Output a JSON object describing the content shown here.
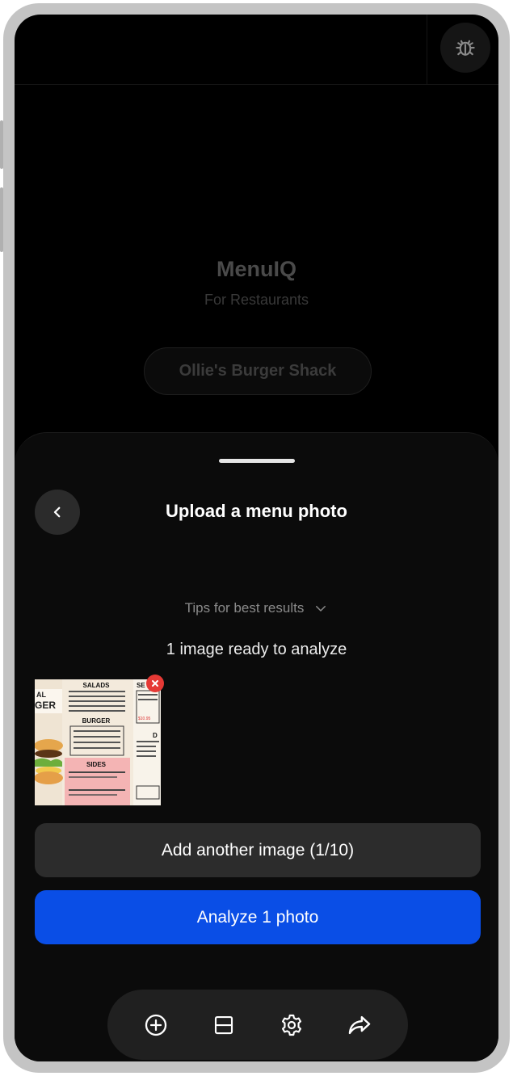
{
  "app": {
    "title": "MenuIQ",
    "subtitle": "For Restaurants",
    "restaurant_name": "Ollie's Burger Shack",
    "debug_icon": "bug-icon"
  },
  "sheet": {
    "title": "Upload a menu photo",
    "back_icon": "chevron-left-icon",
    "tips_label": "Tips for best results",
    "tips_icon": "chevron-down-icon",
    "ready_text": "1 image ready to analyze",
    "thumbnail": {
      "remove_icon": "close-icon",
      "menu_text": {
        "sec_salads": "SALADS",
        "sec_burger": "BURGER",
        "sec_sides": "SIDES",
        "sec_s": "SE",
        "sec_d": "D",
        "brand_left": "AL",
        "brand_left2": "GER",
        "price": "$10.95"
      }
    },
    "add_button_label": "Add another image (1/10)",
    "analyze_button_label": "Analyze 1 photo"
  },
  "toolbar": {
    "items": [
      {
        "icon": "add-circle-icon"
      },
      {
        "icon": "split-view-icon"
      },
      {
        "icon": "gear-icon"
      },
      {
        "icon": "share-icon"
      }
    ]
  },
  "colors": {
    "accent": "#0a4ee6",
    "badge": "#e53935",
    "background": "#000000"
  }
}
